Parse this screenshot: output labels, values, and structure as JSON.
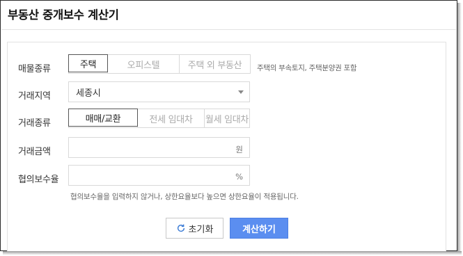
{
  "title": "부동산 중개보수 계산기",
  "property_type": {
    "label": "매물종류",
    "options": [
      "주택",
      "오피스텔",
      "주택 외 부동산"
    ],
    "selected": "주택",
    "hint": "주택의 부속토지, 주택분양권 포함"
  },
  "region": {
    "label": "거래지역",
    "value": "세종시"
  },
  "transaction_type": {
    "label": "거래종류",
    "options": [
      "매매/교환",
      "전세 임대차",
      "월세 임대차"
    ],
    "selected": "매매/교환"
  },
  "amount": {
    "label": "거래금액",
    "value": "",
    "unit": "원"
  },
  "fee_rate": {
    "label": "협의보수율",
    "value": "",
    "unit": "%",
    "note": "협의보수율을 입력하지 않거나, 상한요율보다 높으면 상한요율이 적용됩니다."
  },
  "buttons": {
    "reset_label": "초기화",
    "calc_label": "계산하기"
  },
  "colors": {
    "accent": "#5b8ef0",
    "border": "#d9d9d9"
  }
}
